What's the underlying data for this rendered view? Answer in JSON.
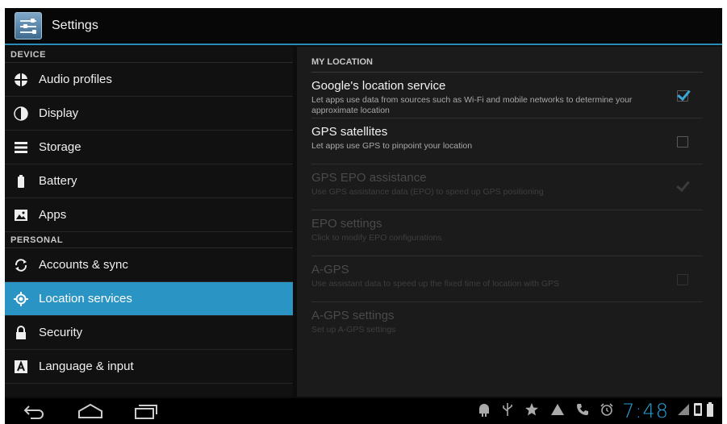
{
  "window": {
    "title": "Settings"
  },
  "sidebar": {
    "sections": [
      {
        "header": "DEVICE",
        "items": [
          {
            "label": "Audio profiles",
            "icon": "audio-profiles-icon"
          },
          {
            "label": "Display",
            "icon": "display-icon"
          },
          {
            "label": "Storage",
            "icon": "storage-icon"
          },
          {
            "label": "Battery",
            "icon": "battery-icon"
          },
          {
            "label": "Apps",
            "icon": "apps-icon"
          }
        ]
      },
      {
        "header": "PERSONAL",
        "items": [
          {
            "label": "Accounts & sync",
            "icon": "sync-icon"
          },
          {
            "label": "Location services",
            "icon": "location-icon",
            "selected": true
          },
          {
            "label": "Security",
            "icon": "lock-icon"
          },
          {
            "label": "Language & input",
            "icon": "language-icon"
          }
        ]
      }
    ]
  },
  "content": {
    "header": "MY LOCATION",
    "prefs": [
      {
        "title": "Google's location service",
        "summary": "Let apps use data from sources such as Wi-Fi and mobile networks to determine your approximate location",
        "checked": true,
        "enabled": true
      },
      {
        "title": "GPS satellites",
        "summary": "Let apps use GPS to pinpoint your location",
        "checked": false,
        "enabled": true
      },
      {
        "title": "GPS EPO assistance",
        "summary": "Use GPS assistance data (EPO) to speed up GPS positioning",
        "checked": true,
        "enabled": false
      },
      {
        "title": "EPO settings",
        "summary": "Click to modify EPO configurations",
        "checked": null,
        "enabled": false
      },
      {
        "title": "A-GPS",
        "summary": "Use assistant data to speed up the fixed time of location with GPS",
        "checked": false,
        "enabled": false
      },
      {
        "title": "A-GPS settings",
        "summary": "Set up A-GPS settings",
        "checked": null,
        "enabled": false
      }
    ]
  },
  "status_bar": {
    "time": "7:48"
  },
  "colors": {
    "accent": "#2a94c4",
    "clock": "#2aa1d8"
  }
}
